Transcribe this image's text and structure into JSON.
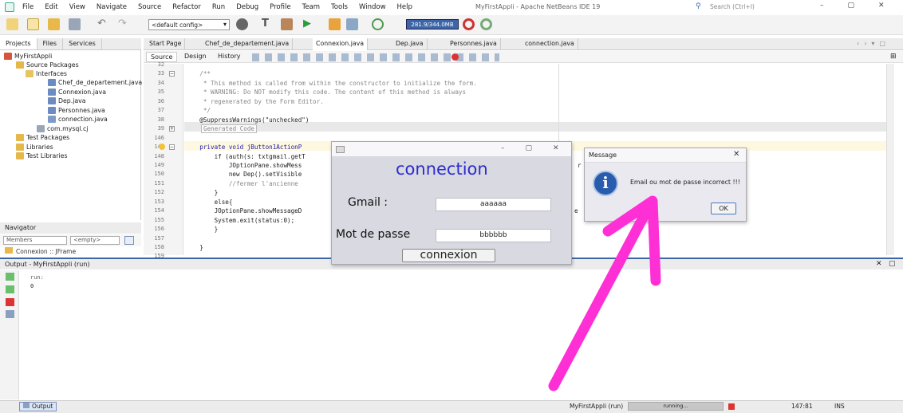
{
  "window": {
    "title": "MyFirstAppli - Apache NetBeans IDE 19",
    "search_placeholder": "Search (Ctrl+I)"
  },
  "menu": [
    "File",
    "Edit",
    "View",
    "Navigate",
    "Source",
    "Refactor",
    "Run",
    "Debug",
    "Profile",
    "Team",
    "Tools",
    "Window",
    "Help"
  ],
  "toolbar": {
    "config": "<default config>",
    "memory": "281.9/344.0MB"
  },
  "left_tabs": [
    "Projects",
    "Files",
    "Services"
  ],
  "tree": {
    "project": "MyFirstAppli",
    "source_packages": "Source Packages",
    "interfaces": "Interfaces",
    "files": [
      "Chef_de_departement.java",
      "Connexion.java",
      "Dep.java",
      "Personnes.java",
      "connection.java"
    ],
    "mysql": "com.mysql.cj",
    "test_packages": "Test Packages",
    "libraries": "Libraries",
    "test_libraries": "Test Libraries"
  },
  "navigator": {
    "title": "Navigator",
    "members": "Members",
    "empty": "<empty>",
    "item": "Connexion :: JFrame"
  },
  "editor_tabs": [
    "Start Page",
    "Chef_de_departement.java",
    "Connexion.java",
    "Dep.java",
    "Personnes.java",
    "connection.java"
  ],
  "view_tabs": [
    "Source",
    "Design",
    "History"
  ],
  "line_numbers": [
    "32",
    "33",
    "34",
    "35",
    "36",
    "37",
    "38",
    "39",
    "146",
    "147",
    "148",
    "149",
    "150",
    "151",
    "152",
    "153",
    "154",
    "155",
    "156",
    "157",
    "158",
    "159"
  ],
  "code": {
    "l33": "    /**",
    "l34": "     * This method is called from within the constructor to initialize the form.",
    "l35": "     * WARNING: Do NOT modify this code. The content of this method is always",
    "l36": "     * regenerated by the Form Editor.",
    "l37": "     */",
    "l38": "    @SuppressWarnings(\"unchecked\")",
    "l39": "Generated Code",
    "l147": "    private void jButton1ActionP",
    "l148": "        if (auth(s: txtgmail.getT",
    "l149": "            JOptionPane.showMess",
    "l150": "            new Dep().setVisible",
    "l151": "            //fermer l'ancienne",
    "l152": "        }",
    "l153": "        else{",
    "l154": "        JOptionPane.showMessageD",
    "l155": "        System.exit(status:0);",
    "l156": "        }",
    "l158": "    }",
    "tail149": "r",
    "tail154": "e"
  },
  "output": {
    "title": "Output - MyFirstAppli (run)",
    "lines": [
      "run:",
      "0"
    ]
  },
  "statusbar": {
    "output_tab": "Output",
    "run_label": "MyFirstAppli (run)",
    "progress": "running...",
    "position": "147:81",
    "mode": "INS"
  },
  "login": {
    "title": "connection",
    "gmail_label": "Gmail :",
    "gmail_value": "aaaaaa",
    "password_label": "Mot de passe",
    "password_value": "bbbbbb",
    "button": "connexion"
  },
  "message": {
    "title": "Message",
    "icon": "info-icon",
    "text": "Email ou mot de passe incorrect !!!",
    "ok": "OK"
  },
  "annotation": {
    "arrow_color": "#ff2fd6"
  }
}
